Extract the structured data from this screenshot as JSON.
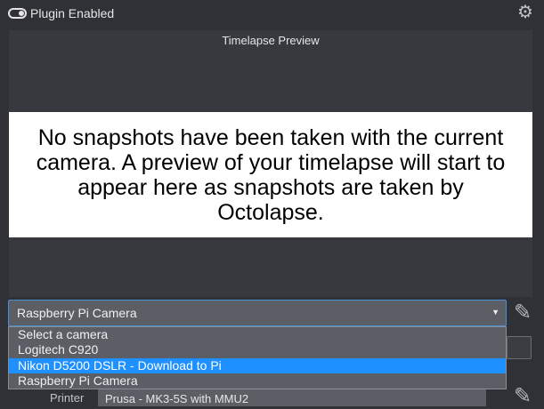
{
  "topbar": {
    "toggle_icon": "toggle-on-icon",
    "plugin_label": "Plugin Enabled",
    "settings_icon": "gear-icon"
  },
  "preview": {
    "title": "Timelapse Preview",
    "message": "No snapshots have been taken with the current camera. A preview of your timelapse will start to appear here as snapshots are taken by Octolapse."
  },
  "camera_select": {
    "value": "Raspberry Pi Camera",
    "options": [
      {
        "label": "Select a camera",
        "selected": false
      },
      {
        "label": "Logitech C920",
        "selected": false
      },
      {
        "label": "Nikon D5200 DSLR - Download to Pi",
        "selected": true
      },
      {
        "label": "Raspberry Pi Camera",
        "selected": false
      }
    ],
    "edit_icon": "pencil-icon"
  },
  "printer": {
    "label": "Printer",
    "value": "Prusa - MK3-5S with MMU2",
    "edit_icon": "pencil-icon"
  },
  "colors": {
    "background": "#2f3136",
    "select_bg": "#5c5e66",
    "highlight": "#1e90ff",
    "focus_border": "#4a90d9"
  }
}
